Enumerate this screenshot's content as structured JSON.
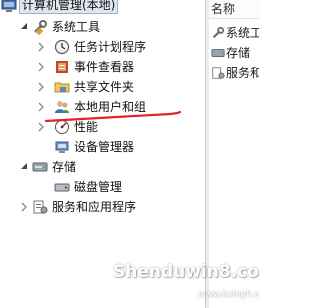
{
  "tree": {
    "root_label": "计算机管理(本地)",
    "nodes": [
      {
        "label": "系统工具",
        "icon": "system-tools-icon"
      },
      {
        "label": "任务计划程序",
        "icon": "clock-icon"
      },
      {
        "label": "事件查看器",
        "icon": "event-viewer-icon"
      },
      {
        "label": "共享文件夹",
        "icon": "shared-folder-icon"
      },
      {
        "label": "本地用户和组",
        "icon": "users-icon"
      },
      {
        "label": "性能",
        "icon": "performance-icon"
      },
      {
        "label": "设备管理器",
        "icon": "device-manager-icon"
      },
      {
        "label": "存储",
        "icon": "storage-icon"
      },
      {
        "label": "磁盘管理",
        "icon": "disk-icon"
      },
      {
        "label": "服务和应用程序",
        "icon": "services-icon"
      }
    ]
  },
  "list": {
    "header": "名称",
    "items": [
      {
        "label": "系统工",
        "icon": "system-tools-icon"
      },
      {
        "label": "存储",
        "icon": "storage-icon"
      },
      {
        "label": "服务和",
        "icon": "services-icon"
      }
    ]
  },
  "watermark": {
    "brand": "Shenduwin8.com",
    "site": "www.kxinyk.com"
  },
  "colors": {
    "annotation_red": "#e8202a",
    "selection_bg": "#dfe6ee"
  }
}
